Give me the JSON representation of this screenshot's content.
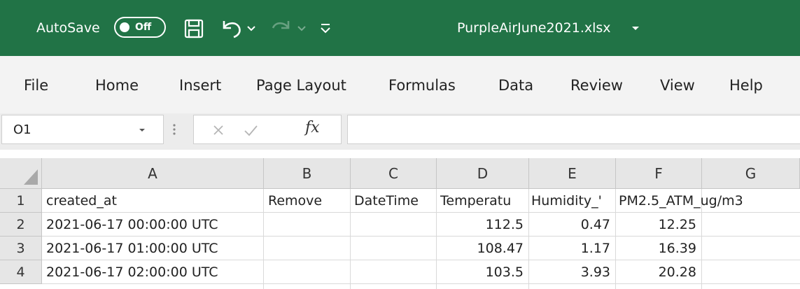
{
  "titlebar": {
    "autosave_label": "AutoSave",
    "autosave_state": "Off",
    "filename": "PurpleAirJune2021.xlsx",
    "bg_color": "#217346",
    "icons": [
      "save-icon",
      "undo-icon",
      "redo-icon",
      "customize-qat-icon",
      "chevron-down-icon"
    ]
  },
  "ribbon": {
    "tabs": [
      "File",
      "Home",
      "Insert",
      "Page Layout",
      "Formulas",
      "Data",
      "Review",
      "View",
      "Help"
    ]
  },
  "formula_bar": {
    "name_box": "O1",
    "fx_label": "fx",
    "formula": ""
  },
  "sheet": {
    "columns": [
      "A",
      "B",
      "C",
      "D",
      "E",
      "F",
      "G"
    ],
    "row_numbers": [
      "1",
      "2",
      "3",
      "4"
    ],
    "header_row": {
      "A": "created_at",
      "B": "Remove",
      "C": "DateTime",
      "D": "Temperatu",
      "E": "Humidity_'",
      "F": "PM2.5_ATM_ug/m3"
    },
    "rows": [
      {
        "A": "2021-06-17 00:00:00 UTC",
        "D": "112.5",
        "E": "0.47",
        "F": "12.25"
      },
      {
        "A": "2021-06-17 01:00:00 UTC",
        "D": "108.47",
        "E": "1.17",
        "F": "16.39"
      },
      {
        "A": "2021-06-17 02:00:00 UTC",
        "D": "103.5",
        "E": "3.93",
        "F": "20.28"
      }
    ]
  }
}
